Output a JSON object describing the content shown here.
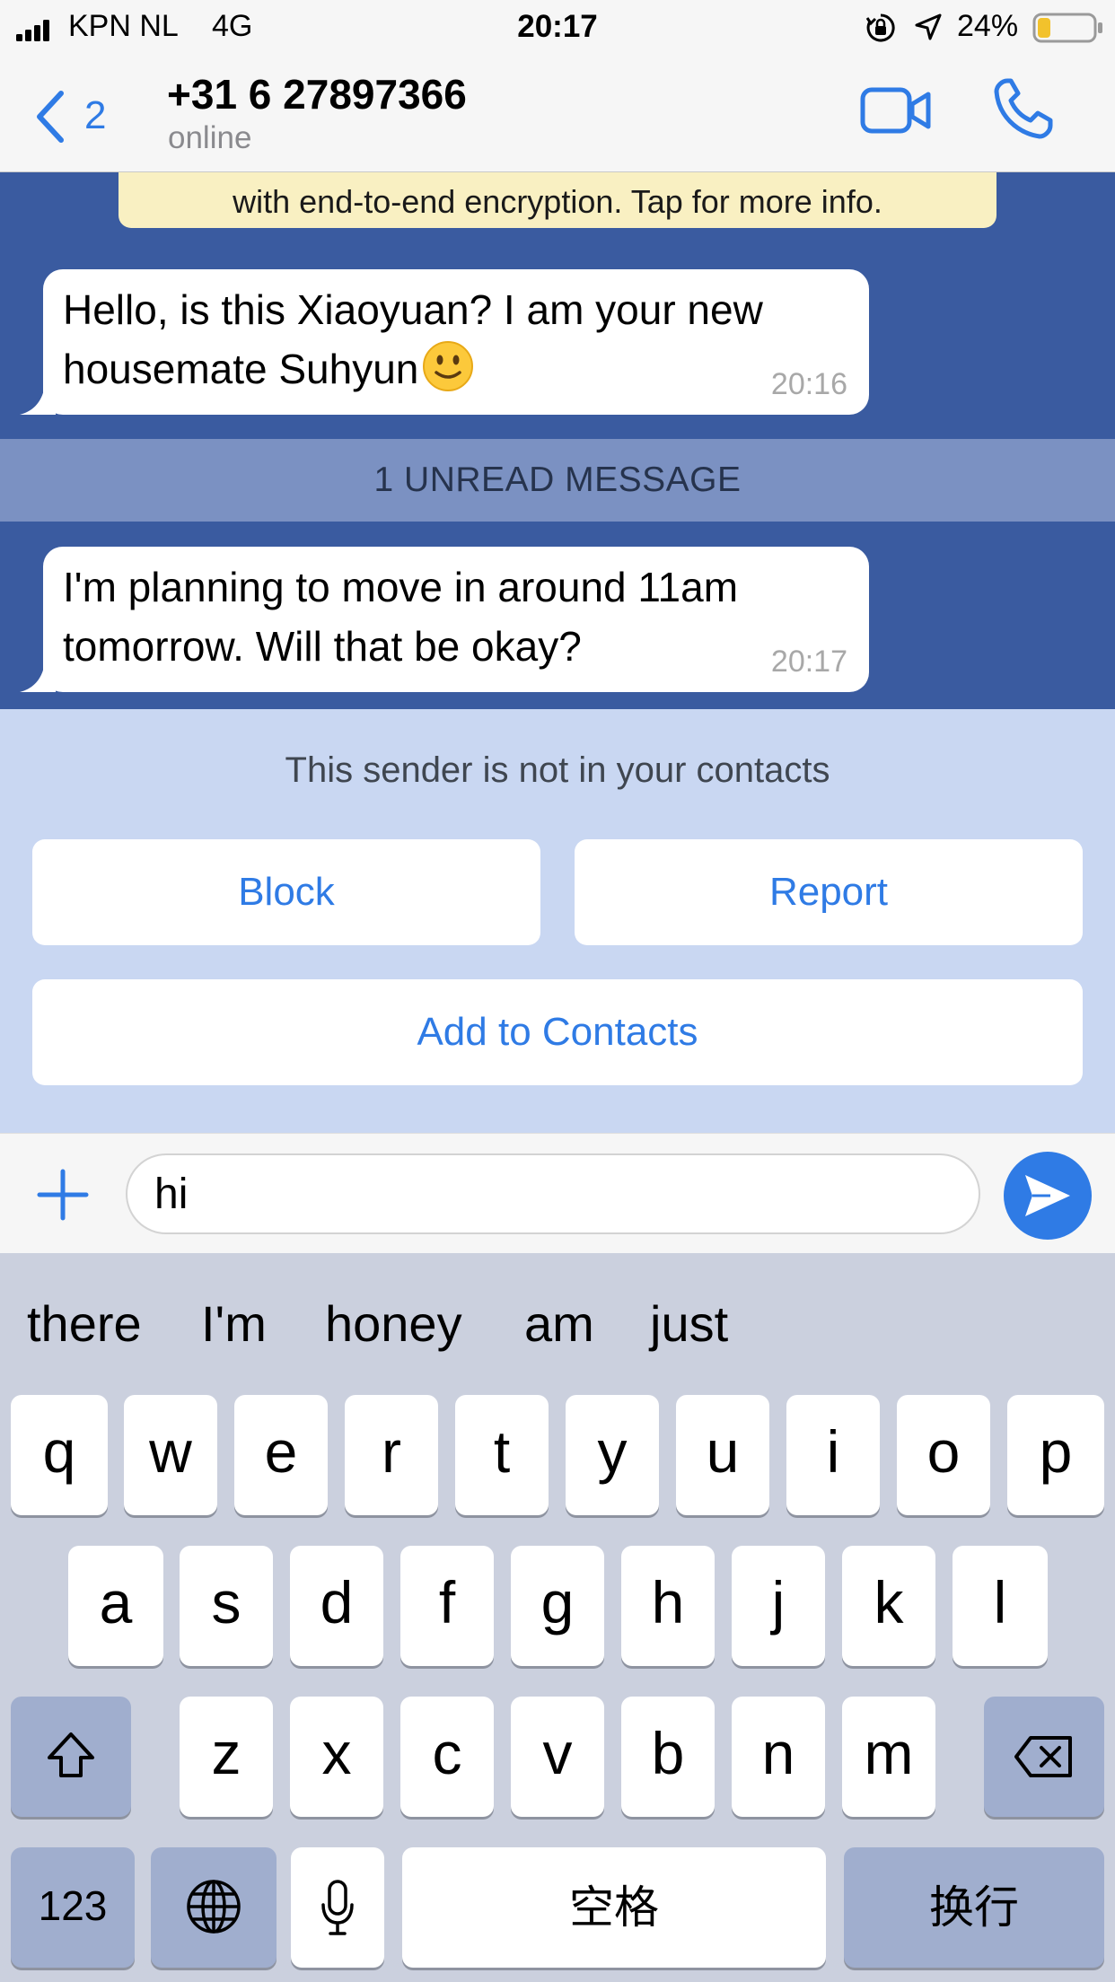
{
  "status_bar": {
    "carrier": "KPN NL",
    "network": "4G",
    "time": "20:17",
    "battery_percent": "24%",
    "battery_level": 0.24
  },
  "header": {
    "back_count": "2",
    "contact_name": "+31 6 27897366",
    "status": "online"
  },
  "chat": {
    "encryption_notice": "with end-to-end encryption. Tap for more info.",
    "messages": [
      {
        "text": "Hello, is this Xiaoyuan? I am your new housemate Suhyun",
        "time": "20:16",
        "emoji": "slightly-smiling-face"
      },
      {
        "text": "I'm planning to move in around 11am tomorrow. Will that be okay?",
        "time": "20:17"
      }
    ],
    "unread_banner": "1 UNREAD MESSAGE"
  },
  "sender_panel": {
    "note": "This sender is not in your contacts",
    "block_label": "Block",
    "report_label": "Report",
    "add_contact_label": "Add to Contacts"
  },
  "composer": {
    "value": "hi"
  },
  "keyboard": {
    "suggestions": [
      "there",
      "I'm",
      "honey",
      "am",
      "just"
    ],
    "row1": [
      "q",
      "w",
      "e",
      "r",
      "t",
      "y",
      "u",
      "i",
      "o",
      "p"
    ],
    "row2": [
      "a",
      "s",
      "d",
      "f",
      "g",
      "h",
      "j",
      "k",
      "l"
    ],
    "row3": [
      "z",
      "x",
      "c",
      "v",
      "b",
      "n",
      "m"
    ],
    "numbers_label": "123",
    "space_label": "空格",
    "return_label": "换行"
  },
  "colors": {
    "accent": "#2f7be5",
    "chat_background": "#3a5ba0",
    "unread_banner": "#7b91c2",
    "panel_background": "#c9d7f2",
    "encryption_notice": "#f9f0c2",
    "keyboard_background": "#cbd0de",
    "function_key": "#a0aece"
  }
}
